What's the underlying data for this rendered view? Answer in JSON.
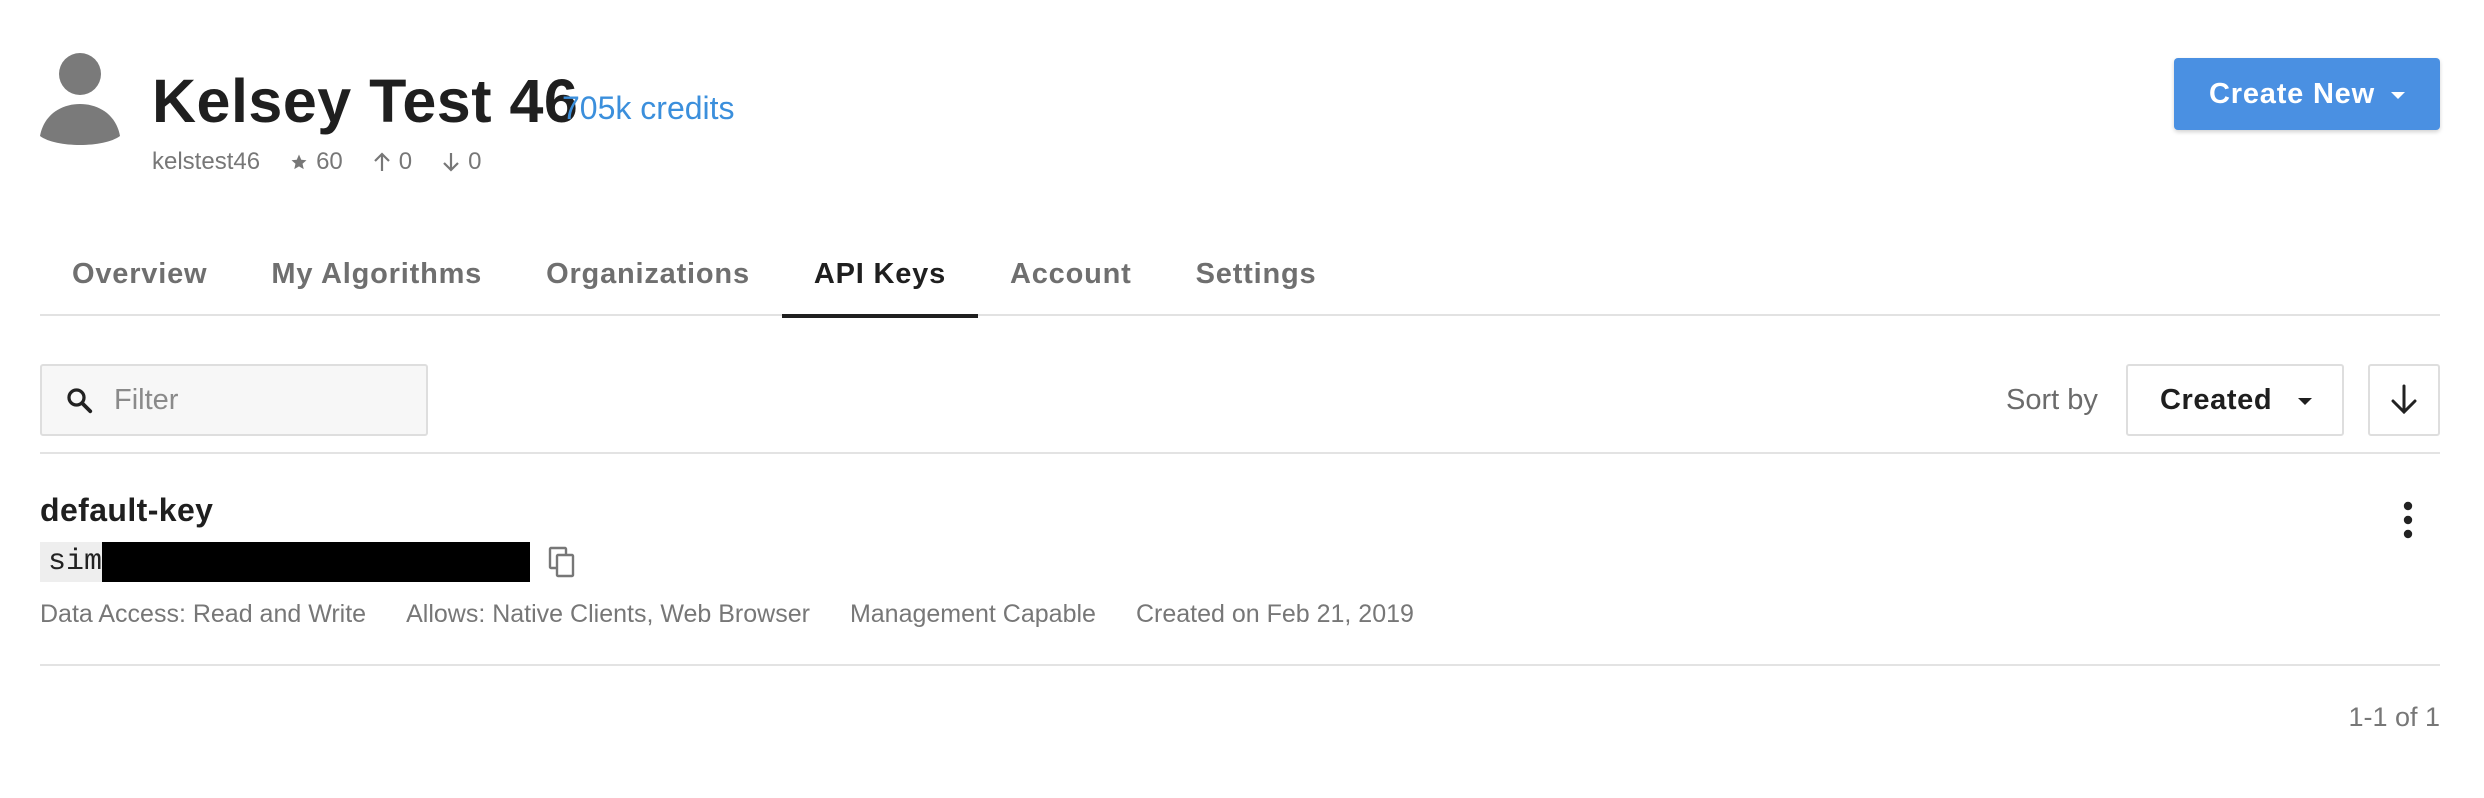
{
  "profile": {
    "display_name": "Kelsey Test 46",
    "credits": "705k credits",
    "username": "kelstest46",
    "stars": "60",
    "followers": "0",
    "following": "0"
  },
  "actions": {
    "create_new_label": "Create New"
  },
  "tabs": [
    {
      "label": "Overview",
      "active": false
    },
    {
      "label": "My Algorithms",
      "active": false
    },
    {
      "label": "Organizations",
      "active": false
    },
    {
      "label": "API Keys",
      "active": true
    },
    {
      "label": "Account",
      "active": false
    },
    {
      "label": "Settings",
      "active": false
    }
  ],
  "toolbar": {
    "filter_placeholder": "Filter",
    "filter_value": "",
    "sort_label": "Sort by",
    "sort_value": "Created",
    "sort_direction": "descending"
  },
  "api_keys": [
    {
      "name": "default-key",
      "key_prefix": "sim",
      "key_redacted": true,
      "data_access": "Data Access: Read and Write",
      "allows": "Allows: Native Clients, Web Browser",
      "management": "Management Capable",
      "created": "Created on Feb 21, 2019"
    }
  ],
  "pagination": {
    "summary": "1-1 of 1"
  },
  "colors": {
    "accent": "#4a90e2",
    "credits": "#3b8fdc",
    "active_tab": "#1f1f1f",
    "muted_text": "#777777",
    "redaction": "#000000"
  },
  "icons": {
    "avatar": "person-avatar-icon",
    "star": "star-icon",
    "followers": "arrow-up-icon",
    "following": "arrow-down-icon",
    "create_caret": "caret-down-icon",
    "filter": "search-icon",
    "sort_caret": "caret-down-icon",
    "sort_direction": "arrow-down-icon",
    "copy": "copy-icon",
    "row_menu": "more-vertical-icon"
  }
}
